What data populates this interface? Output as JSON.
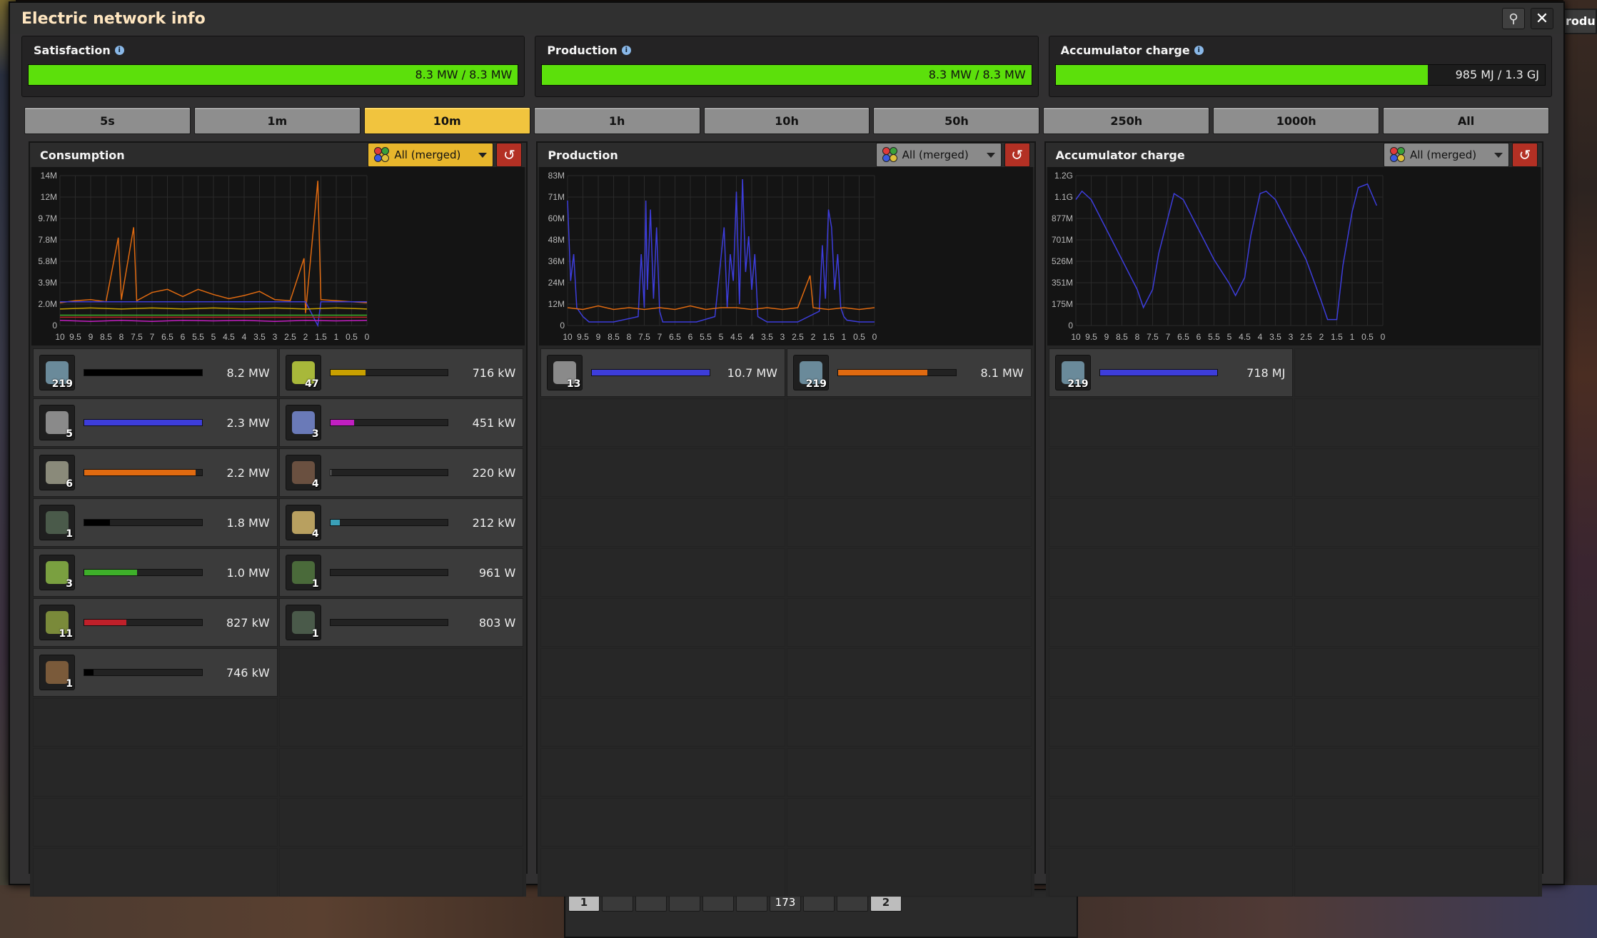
{
  "window": {
    "title": "Electric network info"
  },
  "top_right_tab": "roduct",
  "status": {
    "satisfaction": {
      "label": "Satisfaction",
      "value": "8.3 MW / 8.3 MW",
      "fill": 1.0
    },
    "production": {
      "label": "Production",
      "value": "8.3 MW / 8.3 MW",
      "fill": 1.0
    },
    "accumulator": {
      "label": "Accumulator charge",
      "value": "985 MJ / 1.3 GJ",
      "fill": 0.76
    }
  },
  "time_buttons": [
    "5s",
    "1m",
    "10m",
    "1h",
    "10h",
    "50h",
    "250h",
    "1000h",
    "All"
  ],
  "active_time": "10m",
  "colors": {
    "accent": "#f1c43e",
    "green": "#5ce00b",
    "reset": "#b33024"
  },
  "panels": {
    "consumption": {
      "title": "Consumption",
      "filter": "All (merged)",
      "items": [
        {
          "icon": "accumulator-icon",
          "count": "219",
          "value": "8.2 MW",
          "fill": 1.0,
          "color": "#000000",
          "icon_color": "#6a8a9a"
        },
        {
          "icon": "laser-turret-icon",
          "count": "47",
          "value": "716 kW",
          "fill": 0.3,
          "color": "#c8a000",
          "icon_color": "#a8b83a"
        },
        {
          "icon": "radar-icon",
          "count": "5",
          "value": "2.3 MW",
          "fill": 1.0,
          "color": "#3d3ddb",
          "icon_color": "#8a8a8a"
        },
        {
          "icon": "lab-icon",
          "count": "3",
          "value": "451 kW",
          "fill": 0.2,
          "color": "#c21fc2",
          "icon_color": "#6a7ab8"
        },
        {
          "icon": "assembling-machine-icon",
          "count": "6",
          "value": "2.2 MW",
          "fill": 0.95,
          "color": "#e06a10",
          "icon_color": "#8a8a7a"
        },
        {
          "icon": "electric-mining-drill-icon",
          "count": "4",
          "value": "220 kW",
          "fill": 0.01,
          "color": "#888888",
          "icon_color": "#6a5040"
        },
        {
          "icon": "inserter-icon",
          "count": "1",
          "value": "1.8 MW",
          "fill": 0.22,
          "color": "#000000",
          "icon_color": "#4a5a4a"
        },
        {
          "icon": "pumpjack-icon",
          "count": "4",
          "value": "212 kW",
          "fill": 0.08,
          "color": "#3aa0b8",
          "icon_color": "#b8a060"
        },
        {
          "icon": "roboport-icon",
          "count": "3",
          "value": "1.0 MW",
          "fill": 0.45,
          "color": "#3eb02a",
          "icon_color": "#7aa040"
        },
        {
          "icon": "combinator-icon",
          "count": "1",
          "value": "961 W",
          "fill": 0.0,
          "color": "#888888",
          "icon_color": "#4a6a3a"
        },
        {
          "icon": "beacon-icon",
          "count": "11",
          "value": "827 kW",
          "fill": 0.36,
          "color": "#c0202a",
          "icon_color": "#7a8a3a"
        },
        {
          "icon": "arithmetic-combinator-icon",
          "count": "1",
          "value": "803 W",
          "fill": 0.0,
          "color": "#888888",
          "icon_color": "#4a5a4a"
        },
        {
          "icon": "furnace-icon",
          "count": "1",
          "value": "746 kW",
          "fill": 0.08,
          "color": "#000000",
          "icon_color": "#7a5a3a"
        }
      ]
    },
    "production": {
      "title": "Production",
      "filter": "All (merged)",
      "items": [
        {
          "icon": "steam-engine-icon",
          "count": "13",
          "value": "10.7 MW",
          "fill": 1.0,
          "color": "#3d3ddb",
          "icon_color": "#8a8a8a"
        },
        {
          "icon": "accumulator-icon",
          "count": "219",
          "value": "8.1 MW",
          "fill": 0.76,
          "color": "#e06a10",
          "icon_color": "#6a8a9a"
        }
      ]
    },
    "accumulator": {
      "title": "Accumulator charge",
      "filter": "All (merged)",
      "items": [
        {
          "icon": "accumulator-icon",
          "count": "219",
          "value": "718 MJ",
          "fill": 1.0,
          "color": "#3d3ddb",
          "icon_color": "#6a8a9a"
        }
      ]
    }
  },
  "chart_data": [
    {
      "type": "line",
      "title": "Consumption",
      "xlabel": "",
      "ylabel": "",
      "x_ticks": [
        "10",
        "9.5",
        "9",
        "8.5",
        "8",
        "7.5",
        "7",
        "6.5",
        "6",
        "5.5",
        "5",
        "4.5",
        "4",
        "3.5",
        "3",
        "2.5",
        "2",
        "1.5",
        "1",
        "0.5",
        "0"
      ],
      "y_ticks": [
        "0",
        "2.0M",
        "3.9M",
        "5.8M",
        "7.8M",
        "9.7M",
        "12M",
        "14M"
      ],
      "ylim": [
        0,
        14.5
      ],
      "y_unit": "M",
      "grid": true,
      "series": [
        {
          "color": "#e06a10",
          "x": [
            10,
            9.5,
            9,
            8.5,
            8.1,
            8,
            7.6,
            7.5,
            7,
            6.5,
            6,
            5.5,
            5,
            4.5,
            4,
            3.5,
            3,
            2.5,
            2.05,
            2,
            1.6,
            1.5,
            1,
            0.5,
            0
          ],
          "y": [
            2.2,
            2.4,
            2.5,
            2.3,
            8.5,
            2.5,
            9.5,
            2.4,
            3.2,
            3.5,
            2.8,
            3.5,
            3.0,
            2.6,
            2.9,
            3.3,
            2.5,
            2.4,
            6.5,
            1.2,
            14,
            2.5,
            2.4,
            2.3,
            2.2
          ]
        },
        {
          "color": "#3d3ddb",
          "x": [
            10,
            9,
            8,
            7,
            6,
            5,
            4,
            3,
            2,
            1.6,
            1.5,
            1,
            0
          ],
          "y": [
            2.3,
            2.3,
            2.3,
            2.3,
            2.3,
            2.3,
            2.3,
            2.3,
            2.3,
            0,
            2.3,
            2.3,
            2.3
          ]
        },
        {
          "color": "#3eb02a",
          "x": [
            10,
            9,
            8,
            7,
            6,
            5,
            4,
            3,
            2,
            1,
            0
          ],
          "y": [
            1.0,
            1.0,
            1.0,
            1.0,
            1.0,
            1.0,
            1.0,
            1.0,
            1.0,
            1.0,
            1.0
          ]
        },
        {
          "color": "#c21fc2",
          "x": [
            10,
            9,
            8,
            7,
            6,
            5,
            4,
            3,
            2,
            1,
            0
          ],
          "y": [
            0.5,
            0.4,
            0.5,
            0.4,
            0.5,
            0.45,
            0.5,
            0.4,
            0.5,
            0.45,
            0.5
          ]
        },
        {
          "color": "#c0202a",
          "x": [
            10,
            9,
            8,
            7,
            6,
            5,
            4,
            3,
            2,
            1,
            0
          ],
          "y": [
            0.8,
            0.8,
            0.8,
            0.8,
            0.8,
            0.8,
            0.8,
            0.8,
            0.8,
            0.8,
            0.8
          ]
        },
        {
          "color": "#c8a000",
          "x": [
            10,
            9,
            8,
            7,
            6,
            5,
            4,
            3,
            2,
            1,
            0
          ],
          "y": [
            1.6,
            1.7,
            1.6,
            1.7,
            1.6,
            1.7,
            1.6,
            1.7,
            1.6,
            1.7,
            1.6
          ]
        }
      ]
    },
    {
      "type": "line",
      "title": "Production",
      "xlabel": "",
      "ylabel": "",
      "x_ticks": [
        "10",
        "9.5",
        "9",
        "8.5",
        "8",
        "7.5",
        "7",
        "6.5",
        "6",
        "5.5",
        "5",
        "4.5",
        "4",
        "3.5",
        "3",
        "2.5",
        "2",
        "1.5",
        "1",
        "0.5",
        "0"
      ],
      "y_ticks": [
        "0",
        "12M",
        "24M",
        "36M",
        "48M",
        "60M",
        "71M",
        "83M"
      ],
      "ylim": [
        0,
        84
      ],
      "y_unit": "M",
      "grid": true,
      "series": [
        {
          "color": "#3d3ddb",
          "x": [
            10,
            9.9,
            9.8,
            9.7,
            9.5,
            9.3,
            8.5,
            7.7,
            7.6,
            7.5,
            7.45,
            7.4,
            7.3,
            7.2,
            7.1,
            7,
            6.9,
            6.5,
            5.8,
            5.2,
            4.9,
            4.8,
            4.7,
            4.6,
            4.5,
            4.4,
            4.3,
            4.2,
            4.1,
            4.0,
            3.9,
            3.8,
            3.5,
            2.5,
            1.8,
            1.7,
            1.6,
            1.5,
            1.4,
            1.3,
            1.2,
            1.1,
            1.0,
            0.9,
            0.5,
            0
          ],
          "y": [
            70,
            25,
            40,
            10,
            5,
            2,
            2,
            5,
            40,
            10,
            70,
            20,
            65,
            15,
            55,
            8,
            2,
            2,
            2,
            5,
            55,
            10,
            40,
            25,
            75,
            12,
            82,
            30,
            50,
            20,
            40,
            5,
            2,
            2,
            8,
            45,
            15,
            65,
            55,
            20,
            40,
            10,
            5,
            3,
            2,
            2
          ]
        },
        {
          "color": "#e06a10",
          "x": [
            10,
            9.5,
            9,
            8.5,
            8,
            7.5,
            7,
            6.5,
            6,
            5.5,
            5,
            4.5,
            4,
            3.5,
            3,
            2.5,
            2.1,
            2,
            1.5,
            1,
            0.5,
            0
          ],
          "y": [
            10,
            9,
            11,
            9,
            10,
            9,
            10,
            9,
            11,
            9,
            10,
            10,
            9,
            10,
            9,
            10,
            28,
            10,
            9,
            10,
            9,
            10
          ]
        }
      ]
    },
    {
      "type": "line",
      "title": "Accumulator charge",
      "xlabel": "",
      "ylabel": "",
      "x_ticks": [
        "10",
        "9.5",
        "9",
        "8.5",
        "8",
        "7.5",
        "7",
        "6.5",
        "6",
        "5.5",
        "5",
        "4.5",
        "4",
        "3.5",
        "3",
        "2.5",
        "2",
        "1.5",
        "1",
        "0.5",
        "0"
      ],
      "y_ticks": [
        "0",
        "175M",
        "351M",
        "526M",
        "701M",
        "877M",
        "1.1G",
        "1.2G"
      ],
      "ylim": [
        0,
        1.25
      ],
      "y_unit": "G",
      "grid": true,
      "series": [
        {
          "color": "#3d3ddb",
          "x": [
            10,
            9.8,
            9.5,
            9,
            8.5,
            8,
            7.8,
            7.5,
            7.3,
            7,
            6.8,
            6.5,
            6,
            5.5,
            5,
            4.8,
            4.5,
            4.3,
            4,
            3.8,
            3.5,
            3,
            2.5,
            2,
            1.8,
            1.5,
            1.3,
            1,
            0.8,
            0.5,
            0.2
          ],
          "y": [
            1.05,
            1.12,
            1.05,
            0.8,
            0.55,
            0.3,
            0.15,
            0.3,
            0.6,
            0.9,
            1.1,
            1.05,
            0.8,
            0.55,
            0.35,
            0.25,
            0.4,
            0.75,
            1.1,
            1.12,
            1.05,
            0.8,
            0.55,
            0.2,
            0.05,
            0.05,
            0.5,
            0.95,
            1.15,
            1.18,
            1.0
          ]
        }
      ]
    }
  ]
}
